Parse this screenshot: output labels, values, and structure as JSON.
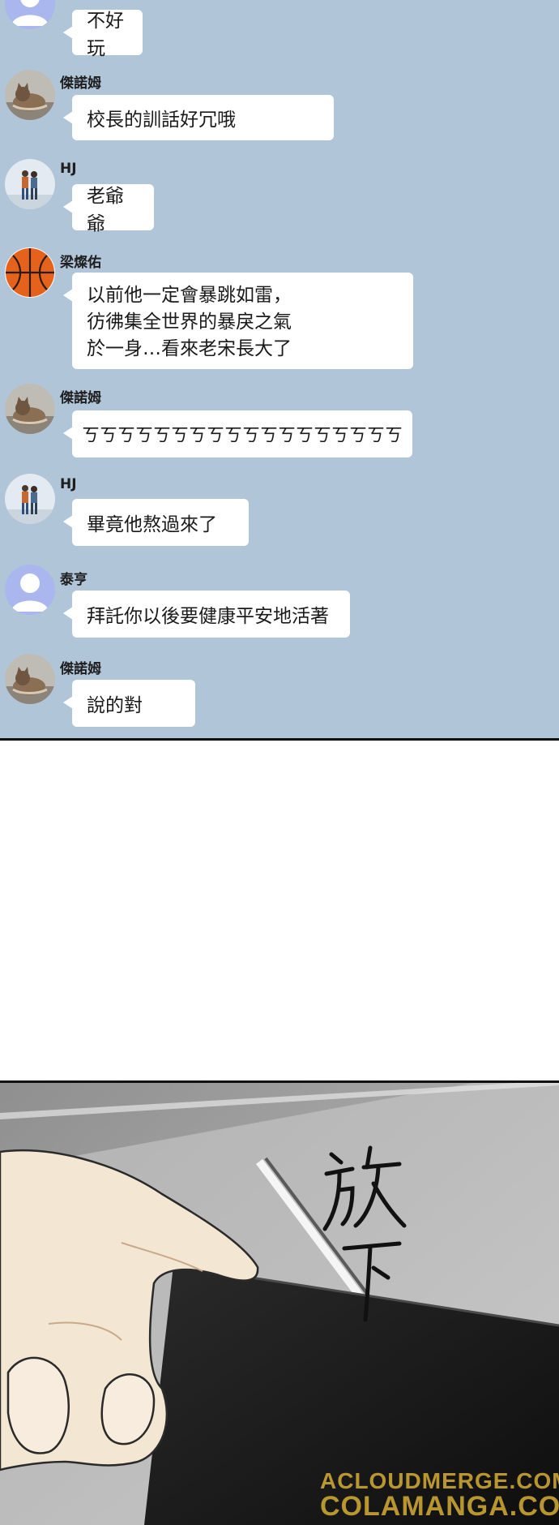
{
  "chat": {
    "messages": [
      {
        "sender": "",
        "text": "不好玩",
        "avatar": "default-user-icon"
      },
      {
        "sender": "傑諾姆",
        "text": "校長的訓話好冗哦",
        "avatar": "cat-avatar"
      },
      {
        "sender": "HJ",
        "text": "老爺爺",
        "avatar": "couple-avatar"
      },
      {
        "sender": "梁燦佑",
        "lines": [
          "以前他一定會暴跳如雷，",
          "彷彿集全世界的暴戾之氣",
          "於一身…看來老宋長大了"
        ],
        "avatar": "basketball-avatar"
      },
      {
        "sender": "傑諾姆",
        "text": "ㄎㄎㄎㄎㄎㄎㄎㄎㄎㄎㄎㄎㄎㄎㄎㄎㄎㄎ",
        "avatar": "cat-avatar"
      },
      {
        "sender": "HJ",
        "text": "畢竟他熬過來了",
        "avatar": "couple-avatar"
      },
      {
        "sender": "泰亨",
        "text": "拜託你以後要健康平安地活著",
        "avatar": "default-user-icon"
      },
      {
        "sender": "傑諾姆",
        "text": "說的對",
        "avatar": "cat-avatar"
      }
    ]
  },
  "scene": {
    "sound_effect": "放下",
    "watermark_line1": "ACLOUDMERGE.COM",
    "watermark_line2": "COLAMANGA.COM"
  },
  "colors": {
    "chat_background": "#b1c5d8",
    "bubble": "#ffffff",
    "phone": "#151515",
    "skin": "#f3e6d3",
    "watermark": "#f0c239"
  }
}
